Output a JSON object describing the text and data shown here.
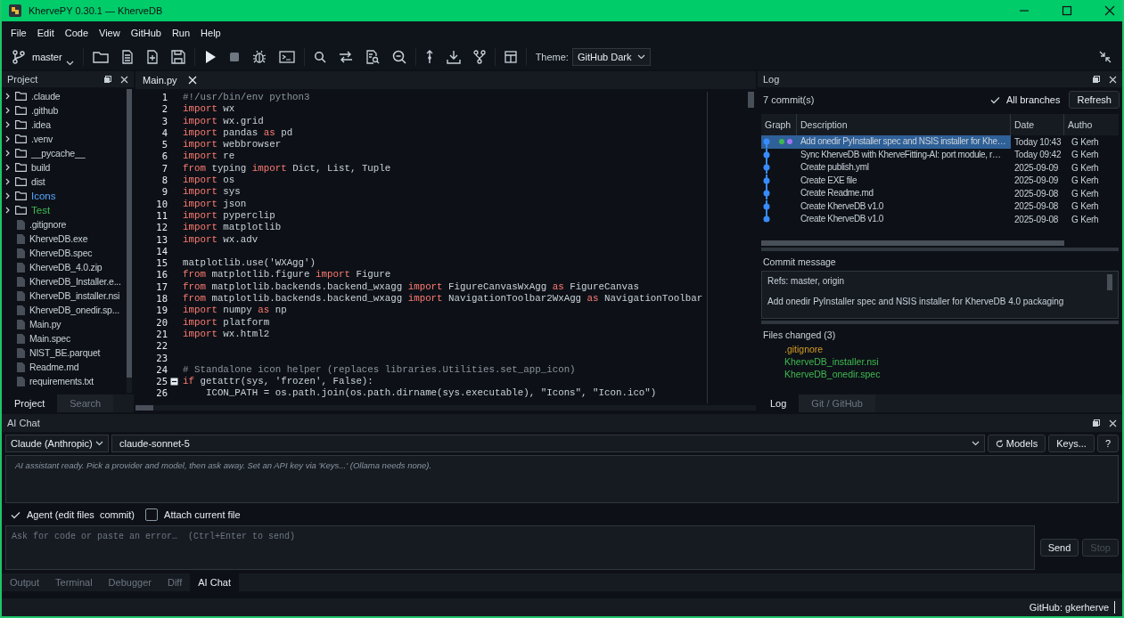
{
  "window": {
    "title": "KhervePY 0.30.1 — KherveDB"
  },
  "menu": [
    "File",
    "Edit",
    "Code",
    "View",
    "GitHub",
    "Run",
    "Help"
  ],
  "toolbar": {
    "branch": "master",
    "theme_label": "Theme:",
    "theme": "GitHub Dark"
  },
  "project_panel": {
    "title": "Project",
    "items": [
      {
        "name": ".claude",
        "kind": "folder",
        "expanded": false
      },
      {
        "name": ".github",
        "kind": "folder",
        "expanded": false
      },
      {
        "name": ".idea",
        "kind": "folder",
        "expanded": false
      },
      {
        "name": ".venv",
        "kind": "folder",
        "expanded": false
      },
      {
        "name": "__pycache__",
        "kind": "folder",
        "expanded": false
      },
      {
        "name": "build",
        "kind": "folder",
        "expanded": false
      },
      {
        "name": "dist",
        "kind": "folder",
        "expanded": false
      },
      {
        "name": "Icons",
        "kind": "folder",
        "expanded": false,
        "color": "#58a6ff"
      },
      {
        "name": "Test",
        "kind": "folder",
        "expanded": false,
        "color": "#3fb950"
      },
      {
        "name": ".gitignore",
        "kind": "file"
      },
      {
        "name": "KherveDB.exe",
        "kind": "file"
      },
      {
        "name": "KherveDB.spec",
        "kind": "file"
      },
      {
        "name": "KherveDB_4.0.zip",
        "kind": "file"
      },
      {
        "name": "KherveDB_Installer.e...",
        "kind": "file"
      },
      {
        "name": "KherveDB_installer.nsi",
        "kind": "file"
      },
      {
        "name": "KherveDB_onedir.sp...",
        "kind": "file"
      },
      {
        "name": "Main.py",
        "kind": "file"
      },
      {
        "name": "Main.spec",
        "kind": "file"
      },
      {
        "name": "NIST_BE.parquet",
        "kind": "file"
      },
      {
        "name": "Readme.md",
        "kind": "file"
      },
      {
        "name": "requirements.txt",
        "kind": "file"
      }
    ],
    "tabs": [
      {
        "label": "Project",
        "selected": true
      },
      {
        "label": "Search",
        "selected": false
      }
    ]
  },
  "editor": {
    "tabs": [
      {
        "label": "Main.py",
        "selected": true
      }
    ],
    "lines": [
      {
        "number": "1",
        "fold": false,
        "segments": [
          {
            "text": "#!/usr/bin/env python3",
            "kind": "comment"
          }
        ]
      },
      {
        "number": "2",
        "fold": false,
        "segments": [
          {
            "text": "import",
            "kind": "keyword"
          },
          {
            "text": " wx",
            "kind": "plain"
          }
        ]
      },
      {
        "number": "3",
        "fold": false,
        "segments": [
          {
            "text": "import",
            "kind": "keyword"
          },
          {
            "text": " wx.grid",
            "kind": "plain"
          }
        ]
      },
      {
        "number": "4",
        "fold": false,
        "segments": [
          {
            "text": "import",
            "kind": "keyword"
          },
          {
            "text": " pandas ",
            "kind": "plain"
          },
          {
            "text": "as",
            "kind": "keyword"
          },
          {
            "text": " pd",
            "kind": "plain"
          }
        ]
      },
      {
        "number": "5",
        "fold": false,
        "segments": [
          {
            "text": "import",
            "kind": "keyword"
          },
          {
            "text": " webbrowser",
            "kind": "plain"
          }
        ]
      },
      {
        "number": "6",
        "fold": false,
        "segments": [
          {
            "text": "import",
            "kind": "keyword"
          },
          {
            "text": " re",
            "kind": "plain"
          }
        ]
      },
      {
        "number": "7",
        "fold": false,
        "segments": [
          {
            "text": "from",
            "kind": "keyword"
          },
          {
            "text": " typing ",
            "kind": "plain"
          },
          {
            "text": "import",
            "kind": "keyword"
          },
          {
            "text": " Dict, List, Tuple",
            "kind": "plain"
          }
        ]
      },
      {
        "number": "8",
        "fold": false,
        "segments": [
          {
            "text": "import",
            "kind": "keyword"
          },
          {
            "text": " os",
            "kind": "plain"
          }
        ]
      },
      {
        "number": "9",
        "fold": false,
        "segments": [
          {
            "text": "import",
            "kind": "keyword"
          },
          {
            "text": " sys",
            "kind": "plain"
          }
        ]
      },
      {
        "number": "10",
        "fold": false,
        "segments": [
          {
            "text": "import",
            "kind": "keyword"
          },
          {
            "text": " json",
            "kind": "plain"
          }
        ]
      },
      {
        "number": "11",
        "fold": false,
        "segments": [
          {
            "text": "import",
            "kind": "keyword"
          },
          {
            "text": " pyperclip",
            "kind": "plain"
          }
        ]
      },
      {
        "number": "12",
        "fold": false,
        "segments": [
          {
            "text": "import",
            "kind": "keyword"
          },
          {
            "text": " matplotlib",
            "kind": "plain"
          }
        ]
      },
      {
        "number": "13",
        "fold": false,
        "segments": [
          {
            "text": "import",
            "kind": "keyword"
          },
          {
            "text": " wx.adv",
            "kind": "plain"
          }
        ]
      },
      {
        "number": "14",
        "fold": false
      },
      {
        "number": "15",
        "fold": false,
        "segments": [
          {
            "text": "matplotlib.use('WXAgg')",
            "kind": "plain"
          }
        ]
      },
      {
        "number": "16",
        "fold": false,
        "segments": [
          {
            "text": "from",
            "kind": "keyword"
          },
          {
            "text": " matplotlib.figure ",
            "kind": "plain"
          },
          {
            "text": "import",
            "kind": "keyword"
          },
          {
            "text": " Figure",
            "kind": "plain"
          }
        ]
      },
      {
        "number": "17",
        "fold": false,
        "segments": [
          {
            "text": "from",
            "kind": "keyword"
          },
          {
            "text": " matplotlib.backends.backend_wxagg ",
            "kind": "plain"
          },
          {
            "text": "import",
            "kind": "keyword"
          },
          {
            "text": " FigureCanvasWxAgg ",
            "kind": "plain"
          },
          {
            "text": "as",
            "kind": "keyword"
          },
          {
            "text": " FigureCanvas",
            "kind": "plain"
          }
        ]
      },
      {
        "number": "18",
        "fold": false,
        "segments": [
          {
            "text": "from",
            "kind": "keyword"
          },
          {
            "text": " matplotlib.backends.backend_wxagg ",
            "kind": "plain"
          },
          {
            "text": "import",
            "kind": "keyword"
          },
          {
            "text": " NavigationToolbar2WxAgg ",
            "kind": "plain"
          },
          {
            "text": "as",
            "kind": "keyword"
          },
          {
            "text": " NavigationToolbar",
            "kind": "plain"
          }
        ]
      },
      {
        "number": "19",
        "fold": false,
        "segments": [
          {
            "text": "import",
            "kind": "keyword"
          },
          {
            "text": " numpy ",
            "kind": "plain"
          },
          {
            "text": "as",
            "kind": "keyword"
          },
          {
            "text": " np",
            "kind": "plain"
          }
        ]
      },
      {
        "number": "20",
        "fold": false,
        "segments": [
          {
            "text": "import",
            "kind": "keyword"
          },
          {
            "text": " platform",
            "kind": "plain"
          }
        ]
      },
      {
        "number": "21",
        "fold": false,
        "segments": [
          {
            "text": "import",
            "kind": "keyword"
          },
          {
            "text": " wx.html2",
            "kind": "plain"
          }
        ]
      },
      {
        "number": "22",
        "fold": false
      },
      {
        "number": "23",
        "fold": false
      },
      {
        "number": "24",
        "fold": false,
        "segments": [
          {
            "text": "# Standalone icon helper (replaces libraries.Utilities.set_app_icon)",
            "kind": "comment"
          }
        ]
      },
      {
        "number": "25",
        "fold": true,
        "segments": [
          {
            "text": "if",
            "kind": "keyword"
          },
          {
            "text": " getattr(sys, 'frozen', False):",
            "kind": "plain"
          }
        ]
      },
      {
        "number": "26",
        "fold": false,
        "segments": [
          {
            "text": "    ICON_PATH = os.path.join(os.path.dirname(sys.executable), \"Icons\", \"Icon.ico\")",
            "kind": "plain"
          }
        ]
      }
    ]
  },
  "log_panel": {
    "title": "Log",
    "commit_count": "7 commit(s)",
    "all_branches": {
      "label": "All branches",
      "checked": true
    },
    "refresh": "Refresh",
    "columns": [
      "Graph",
      "Description",
      "Date",
      "Autho"
    ],
    "commits": [
      {
        "description": "Add onedir PyInstaller spec and NSIS installer for Khe…",
        "date": "Today 10:43",
        "author": "G Kerh",
        "selected": true,
        "refs": [
          {
            "color": "#3fb950"
          },
          {
            "color": "#a371f7"
          }
        ]
      },
      {
        "description": "Sync KherveDB with KherveFitting-AI: port module, r…",
        "date": "Today 09:42",
        "author": "G Kerh",
        "selected": false
      },
      {
        "description": "Create publish.yml",
        "date": "2025-09-09",
        "author": "G Kerh",
        "selected": false
      },
      {
        "description": "Create EXE file",
        "date": "2025-09-09",
        "author": "G Kerh",
        "selected": false
      },
      {
        "description": "Create Readme.md",
        "date": "2025-09-08",
        "author": "G Kerh",
        "selected": false
      },
      {
        "description": "Create KherveDB v1.0",
        "date": "2025-09-08",
        "author": "G Kerh",
        "selected": false
      },
      {
        "description": "Create KherveDB v1.0",
        "date": "2025-09-08",
        "author": "G Kerh",
        "selected": false
      }
    ],
    "commit_message_label": "Commit message",
    "commit_message": [
      "Refs: master, origin",
      "Add onedir PyInstaller spec and NSIS installer for KherveDB 4.0 packaging"
    ],
    "files_changed_label": "Files changed (3)",
    "files_changed": [
      {
        "name": ".gitignore",
        "color": "#d29922"
      },
      {
        "name": "KherveDB_installer.nsi",
        "color": "#3fb950"
      },
      {
        "name": "KherveDB_onedir.spec",
        "color": "#3fb950"
      }
    ],
    "tabs": [
      {
        "label": "Log",
        "selected": true
      },
      {
        "label": "Git / GitHub",
        "selected": false
      }
    ]
  },
  "ai_chat": {
    "title": "AI Chat",
    "provider": "Claude (Anthropic)",
    "model": "claude-sonnet-5",
    "models_button": "Models",
    "keys_button": "Keys...",
    "help_button": "?",
    "transcript": "AI assistant ready. Pick a provider and model, then ask away. Set an API key via 'Keys...' (Ollama needs none).",
    "agent": {
      "label": "Agent (edit files  commit)",
      "checked": true
    },
    "attach": {
      "label": "Attach current file",
      "checked": false
    },
    "prompt": {
      "placeholder": "Ask for code or paste an error…  (Ctrl+Enter to send)"
    },
    "send": {
      "label": "Send",
      "disabled": false
    },
    "stop": {
      "label": "Stop",
      "disabled": true
    }
  },
  "bottom_tabs": [
    {
      "label": "Output",
      "selected": false
    },
    {
      "label": "Terminal",
      "selected": false
    },
    {
      "label": "Debugger",
      "selected": false
    },
    {
      "label": "Diff",
      "selected": false
    },
    {
      "label": "AI Chat",
      "selected": true
    }
  ],
  "status_bar": {
    "github": "GitHub: gkerherve"
  }
}
